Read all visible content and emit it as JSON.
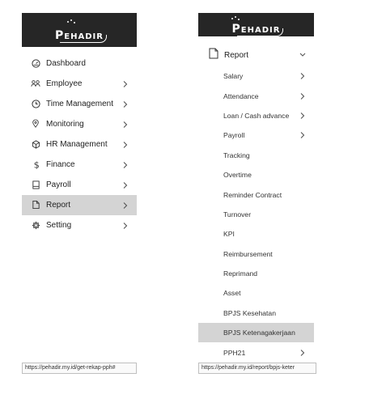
{
  "left": {
    "logo": "PEHADIR",
    "items": [
      {
        "label": "Dashboard",
        "icon": "dashboard-icon",
        "chevron": false,
        "active": false
      },
      {
        "label": "Employee",
        "icon": "users-icon",
        "chevron": true,
        "active": false
      },
      {
        "label": "Time Management",
        "icon": "clock-icon",
        "chevron": true,
        "active": false
      },
      {
        "label": "Monitoring",
        "icon": "location-pin-icon",
        "chevron": true,
        "active": false
      },
      {
        "label": "HR Management",
        "icon": "cube-icon",
        "chevron": true,
        "active": false
      },
      {
        "label": "Finance",
        "icon": "dollar-icon",
        "chevron": true,
        "active": false
      },
      {
        "label": "Payroll",
        "icon": "payroll-book-icon",
        "chevron": true,
        "active": false
      },
      {
        "label": "Report",
        "icon": "document-icon",
        "chevron": true,
        "active": true
      },
      {
        "label": "Setting",
        "icon": "gear-icon",
        "chevron": true,
        "active": false
      }
    ],
    "status_url": "https://pehadir.my.id/get-rekap-pph#"
  },
  "right": {
    "logo": "PEHADIR",
    "report_label": "Report",
    "items": [
      {
        "label": "Salary",
        "chevron": true,
        "active": false
      },
      {
        "label": "Attendance",
        "chevron": true,
        "active": false
      },
      {
        "label": "Loan / Cash advance",
        "chevron": true,
        "active": false
      },
      {
        "label": "Payroll",
        "chevron": true,
        "active": false
      },
      {
        "label": "Tracking",
        "chevron": false,
        "active": false
      },
      {
        "label": "Overtime",
        "chevron": false,
        "active": false
      },
      {
        "label": "Reminder Contract",
        "chevron": false,
        "active": false
      },
      {
        "label": "Turnover",
        "chevron": false,
        "active": false
      },
      {
        "label": "KPI",
        "chevron": false,
        "active": false
      },
      {
        "label": "Reimbursement",
        "chevron": false,
        "active": false
      },
      {
        "label": "Reprimand",
        "chevron": false,
        "active": false
      },
      {
        "label": "Asset",
        "chevron": false,
        "active": false
      },
      {
        "label": "BPJS Kesehatan",
        "chevron": false,
        "active": false
      },
      {
        "label": "BPJS Ketenagakerjaan",
        "chevron": false,
        "active": true
      },
      {
        "label": "PPH21",
        "chevron": true,
        "active": false
      }
    ],
    "status_url": "https://pehadir.my.id/report/bpjs-keter"
  }
}
